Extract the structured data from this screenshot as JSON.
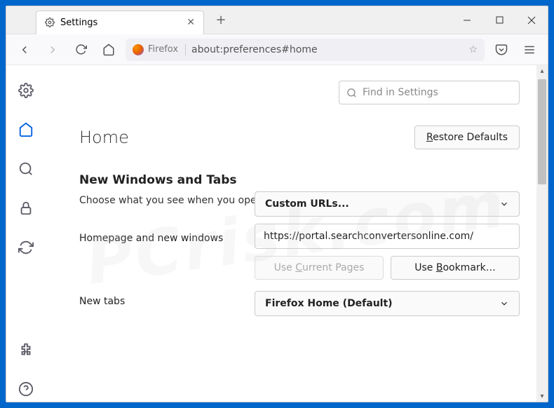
{
  "tab": {
    "title": "Settings"
  },
  "url": {
    "id": "Firefox",
    "value": "about:preferences#home"
  },
  "search": {
    "placeholder": "Find in Settings"
  },
  "page": {
    "title": "Home",
    "restore": "Restore Defaults"
  },
  "section": {
    "heading": "New Windows and Tabs",
    "desc": "Choose what you see when you open your homepage, new windows, and new tabs."
  },
  "homepage": {
    "label": "Homepage and new windows",
    "select": "Custom URLs...",
    "input": "https://portal.searchconvertersonline.com/",
    "useCurrent": "Use Current Pages",
    "useBookmark": "Use Bookmark…"
  },
  "newtabs": {
    "label": "New tabs",
    "select": "Firefox Home (Default)"
  },
  "watermark": "PCrisk.com"
}
